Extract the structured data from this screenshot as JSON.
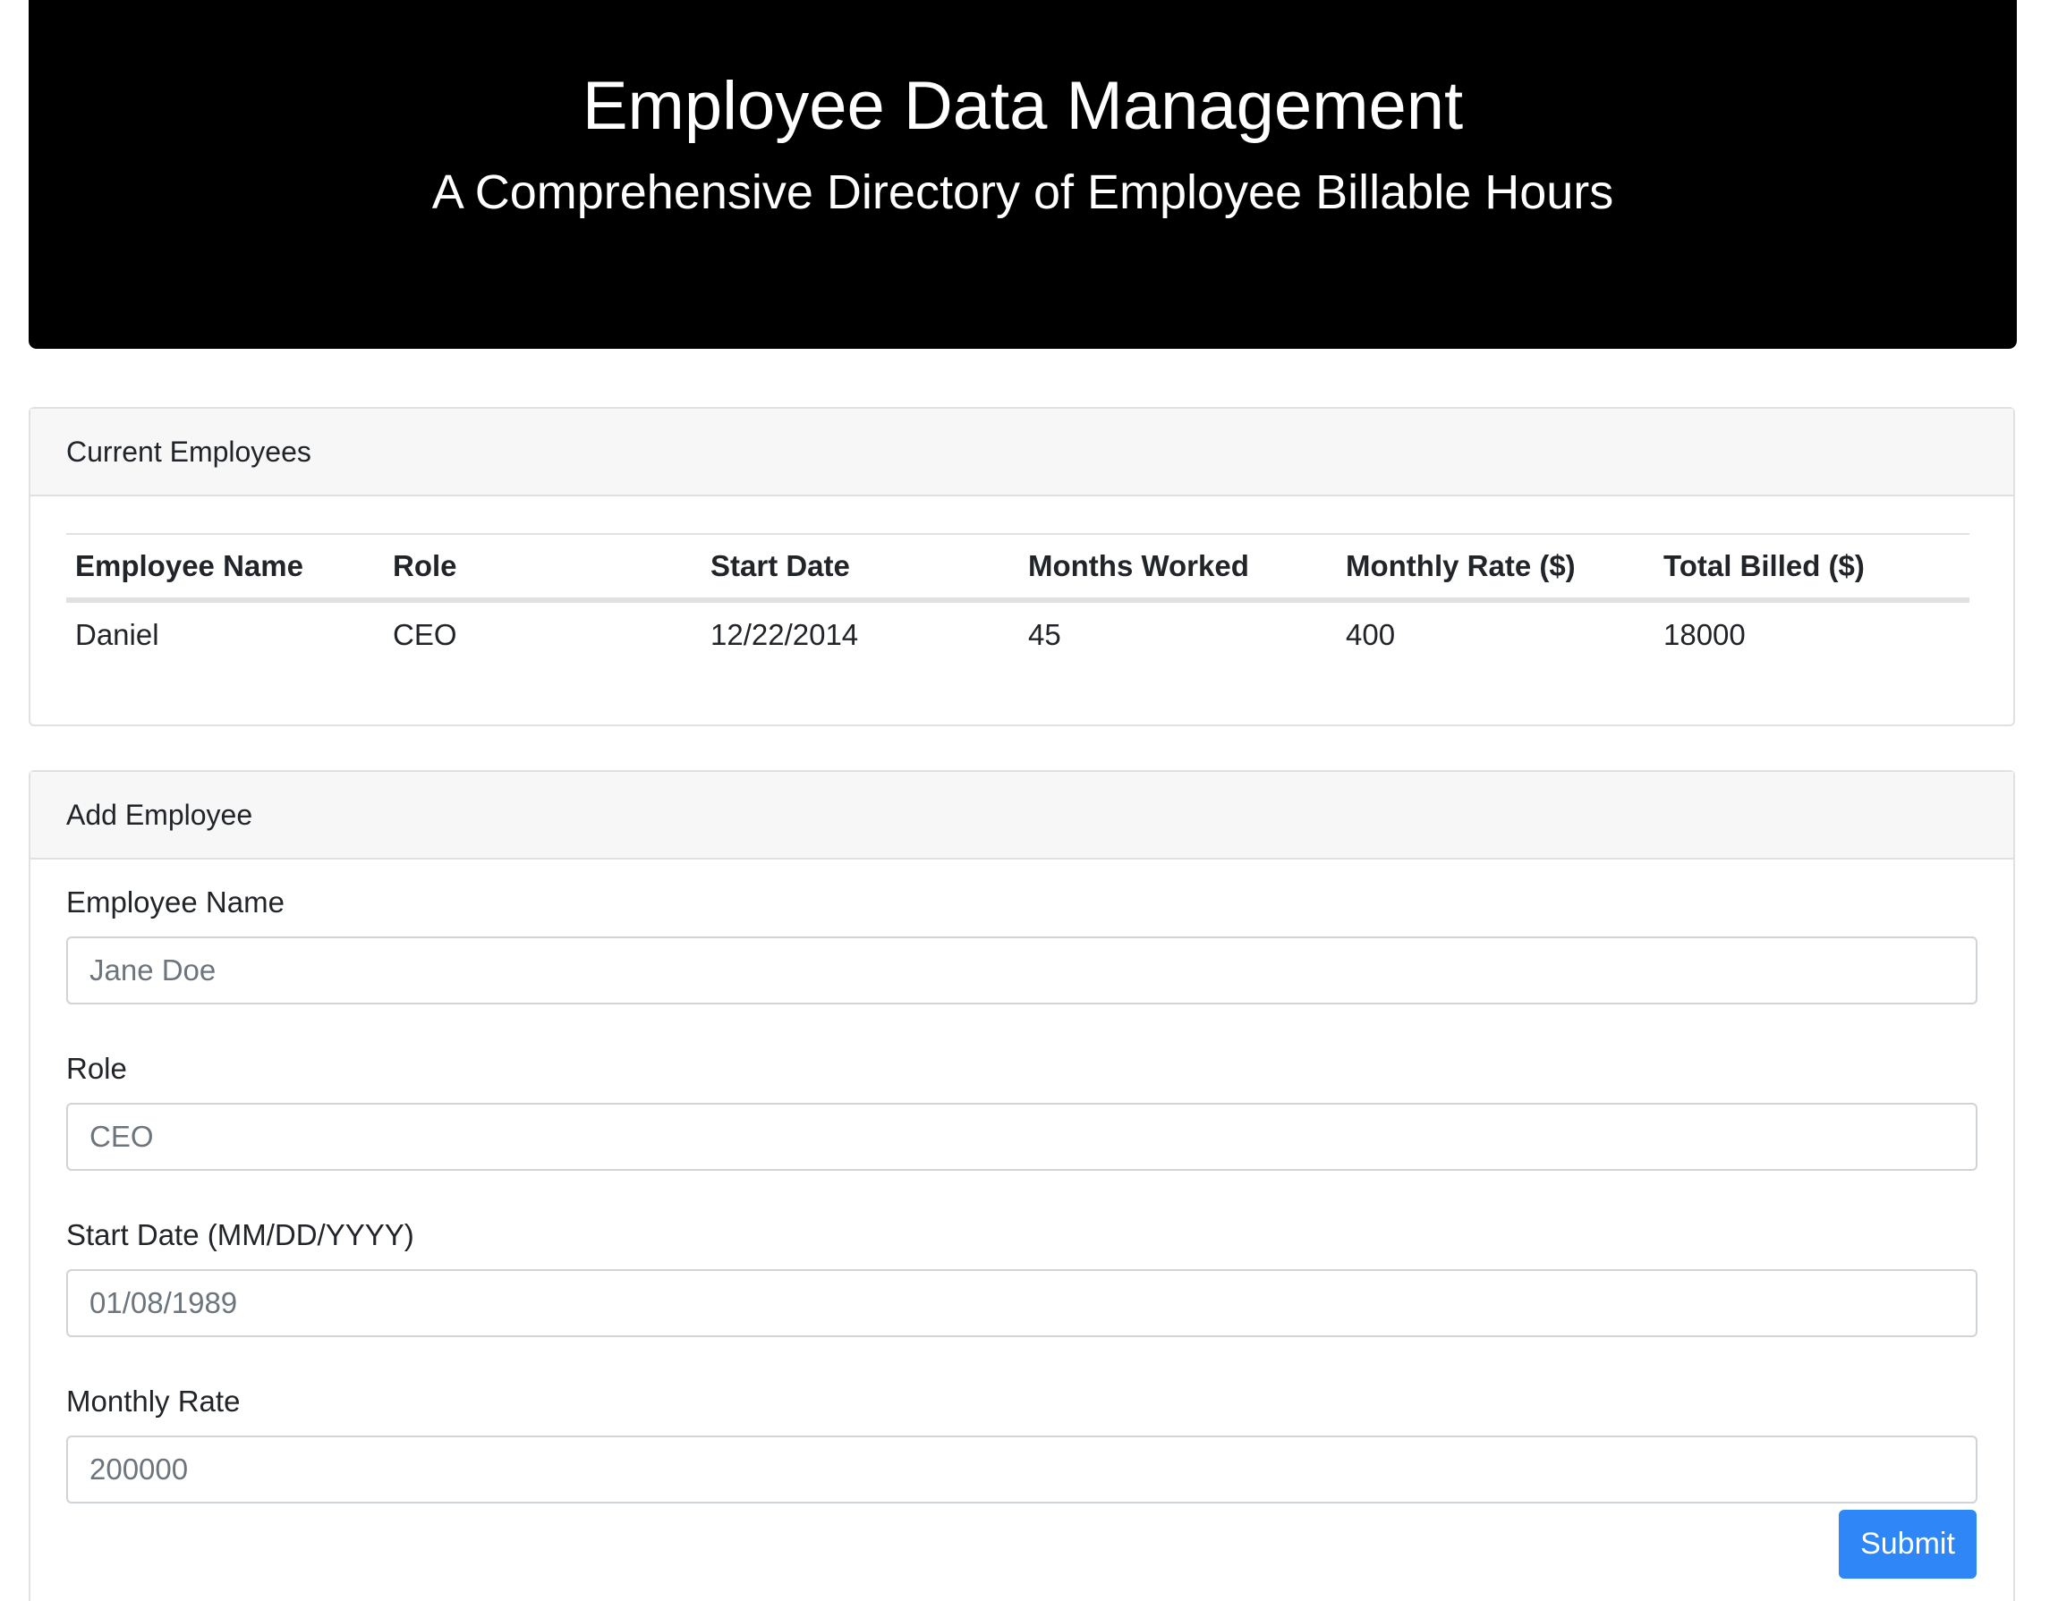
{
  "header": {
    "title": "Employee Data Management",
    "subtitle": "A Comprehensive Directory of Employee Billable Hours"
  },
  "employees_card": {
    "title": "Current Employees",
    "columns": [
      "Employee Name",
      "Role",
      "Start Date",
      "Months Worked",
      "Monthly Rate ($)",
      "Total Billed ($)"
    ],
    "rows": [
      [
        "Daniel",
        "CEO",
        "12/22/2014",
        "45",
        "400",
        "18000"
      ]
    ]
  },
  "add_card": {
    "title": "Add Employee",
    "fields": [
      {
        "label": "Employee Name",
        "placeholder": "Jane Doe"
      },
      {
        "label": "Role",
        "placeholder": "CEO"
      },
      {
        "label": "Start Date (MM/DD/YYYY)",
        "placeholder": "01/08/1989"
      },
      {
        "label": "Monthly Rate",
        "placeholder": "200000"
      }
    ],
    "submit_label": "Submit"
  },
  "colors": {
    "header_bg": "#000000",
    "accent": "#2f86f6",
    "card_header_bg": "#f7f7f7",
    "border": "#e1e1e1"
  }
}
